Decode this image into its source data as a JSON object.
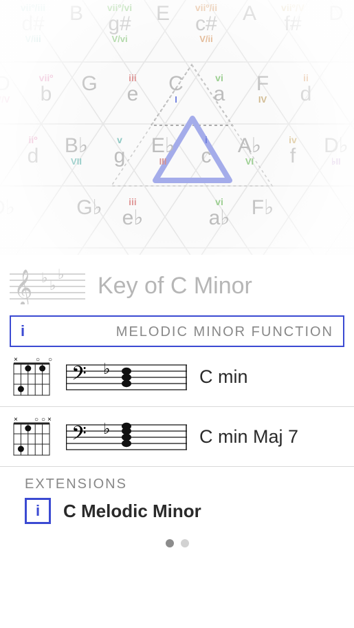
{
  "map": {
    "row0": [
      {
        "func": "viiº/iii",
        "note": "d#",
        "sub": "V/iii",
        "fc": "c-teal",
        "sc": "c-teal2"
      },
      {
        "func": "",
        "note": "B",
        "sub": "",
        "fc": "",
        "sc": ""
      },
      {
        "func": "viiº/vi",
        "note": "g#",
        "sub": "V/vi",
        "fc": "c-green",
        "sc": "c-green"
      },
      {
        "func": "",
        "note": "E",
        "sub": "",
        "fc": "",
        "sc": ""
      },
      {
        "func": "viiº/ii",
        "note": "c#",
        "sub": "V/ii",
        "fc": "c-orange",
        "sc": "c-orange"
      },
      {
        "func": "",
        "note": "A",
        "sub": "",
        "fc": "",
        "sc": ""
      },
      {
        "func": "viiº/V",
        "note": "f#",
        "sub": "",
        "fc": "c-gold",
        "sc": ""
      },
      {
        "func": "",
        "note": "D",
        "sub": "",
        "fc": "",
        "sc": ""
      }
    ],
    "row1": [
      {
        "func": "",
        "note": "D",
        "sub": "V/V",
        "fc": "",
        "sc": "c-pink"
      },
      {
        "func": "viiº",
        "note": "b",
        "sub": "",
        "fc": "c-pink",
        "sc": ""
      },
      {
        "func": "",
        "note": "G",
        "sub": "",
        "fc": "",
        "sc": ""
      },
      {
        "func": "iii",
        "note": "e",
        "sub": "",
        "fc": "c-red",
        "sc": ""
      },
      {
        "func": "",
        "note": "C",
        "sub": "I",
        "fc": "",
        "sc": "c-blue"
      },
      {
        "func": "vi",
        "note": "a",
        "sub": "",
        "fc": "c-green",
        "sc": ""
      },
      {
        "func": "",
        "note": "F",
        "sub": "IV",
        "fc": "",
        "sc": "c-goldD"
      },
      {
        "func": "ii",
        "note": "d",
        "sub": "",
        "fc": "c-orange",
        "sc": ""
      }
    ],
    "row2": [
      {
        "func": "iiº",
        "note": "d",
        "sub": "",
        "fc": "c-pink",
        "sc": ""
      },
      {
        "func": "",
        "note": "B♭",
        "sub": "VII",
        "fc": "",
        "sc": "c-teal"
      },
      {
        "func": "v",
        "note": "g",
        "sub": "",
        "fc": "c-teal",
        "sc": ""
      },
      {
        "func": "",
        "note": "E♭",
        "sub": "III",
        "fc": "",
        "sc": "c-redb"
      },
      {
        "func": "i",
        "note": "c",
        "sub": "",
        "fc": "c-blue",
        "sc": ""
      },
      {
        "func": "",
        "note": "A♭",
        "sub": "VI",
        "fc": "",
        "sc": "c-green"
      },
      {
        "func": "iv",
        "note": "f",
        "sub": "",
        "fc": "c-gold",
        "sc": ""
      },
      {
        "func": "",
        "note": "D♭",
        "sub": "♭II",
        "fc": "",
        "sc": "c-purple"
      }
    ],
    "row3": [
      {
        "func": "",
        "note": "D♭",
        "sub": "",
        "fc": "",
        "sc": ""
      },
      {
        "func": "",
        "note": "",
        "sub": "",
        "fc": "",
        "sc": ""
      },
      {
        "func": "",
        "note": "G♭",
        "sub": "",
        "fc": "",
        "sc": ""
      },
      {
        "func": "iii",
        "note": "e♭",
        "sub": "",
        "fc": "c-red",
        "sc": ""
      },
      {
        "func": "",
        "note": "",
        "sub": "",
        "fc": "",
        "sc": ""
      },
      {
        "func": "vi",
        "note": "a♭",
        "sub": "",
        "fc": "c-green",
        "sc": ""
      },
      {
        "func": "",
        "note": "F♭",
        "sub": "",
        "fc": "",
        "sc": ""
      },
      {
        "func": "",
        "note": "",
        "sub": "",
        "fc": "",
        "sc": ""
      }
    ]
  },
  "key_title": "Key of C Minor",
  "function_box": {
    "roman": "i",
    "label": "MELODIC MINOR FUNCTION"
  },
  "chords": [
    {
      "name": "C min",
      "marks": "× ○ ○",
      "seventh": false
    },
    {
      "name": "C min Maj 7",
      "marks": "× ○○×",
      "seventh": true
    }
  ],
  "extensions": {
    "label": "EXTENSIONS",
    "badge": "i",
    "name": "C Melodic Minor"
  },
  "pager": {
    "count": 2,
    "active": 0
  }
}
